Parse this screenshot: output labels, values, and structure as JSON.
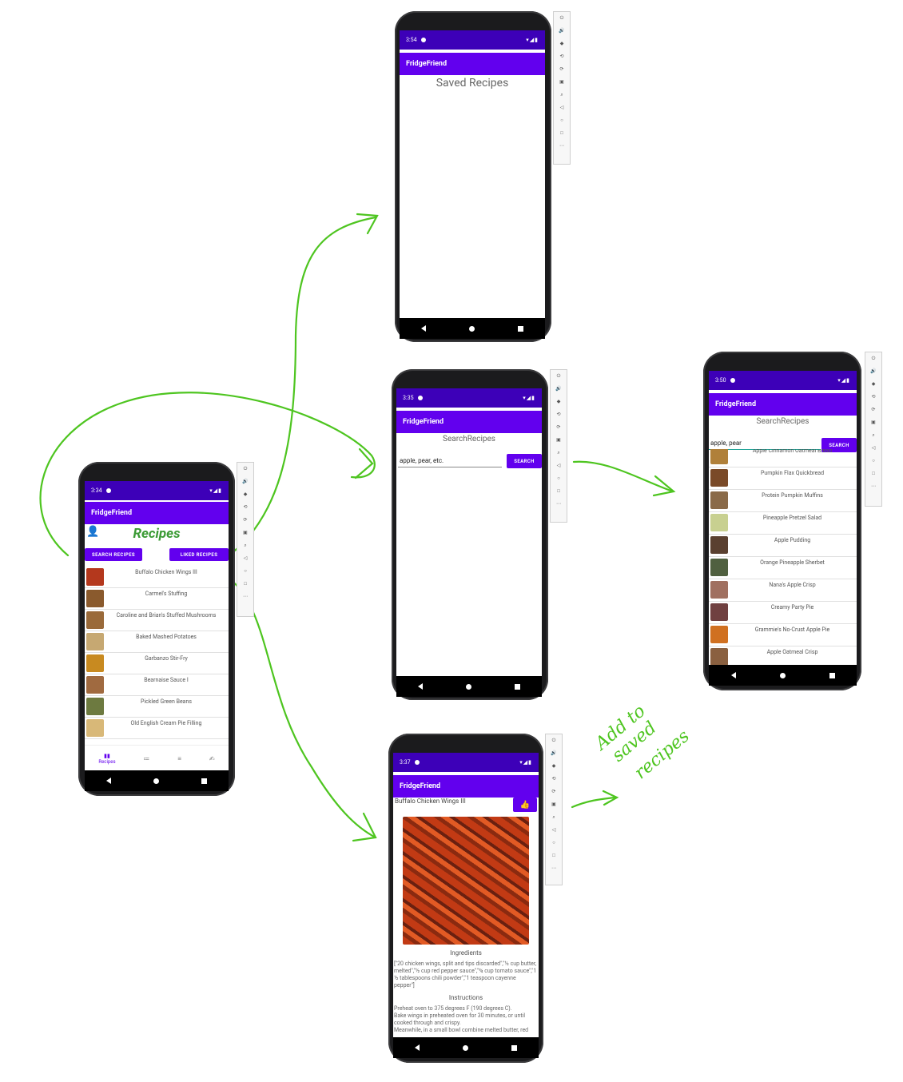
{
  "colors": {
    "accent": "#6200ee",
    "status": "#3d00b8",
    "arrow": "#4ec520",
    "recipes_title": "#3a9a34"
  },
  "screen_main": {
    "time": "3:34",
    "app_title": "FridgeFriend",
    "heading": "Recipes",
    "search_btn": "SEARCH RECIPES",
    "liked_btn": "LIKED RECIPES",
    "recipes": [
      {
        "label": "Buffalo Chicken Wings III",
        "color": "#b4381d"
      },
      {
        "label": "Carmel's Stuffing",
        "color": "#8a5a2d"
      },
      {
        "label": "Caroline and Brian's Stuffed Mushrooms",
        "color": "#9a6a3a"
      },
      {
        "label": "Baked Mashed Potatoes",
        "color": "#c6a872"
      },
      {
        "label": "Garbanzo Stir-Fry",
        "color": "#c88a20"
      },
      {
        "label": "Bearnaise Sauce I",
        "color": "#a06a40"
      },
      {
        "label": "Pickled Green Beans",
        "color": "#6d7a40"
      },
      {
        "label": "Old English Cream Pie Filling",
        "color": "#d8b878"
      }
    ],
    "bottom_nav": {
      "recipes": "Recipes",
      "icon2": "≔",
      "icon3": "≡",
      "icon4": "✍"
    }
  },
  "screen_saved": {
    "time": "3:54",
    "app_title": "FridgeFriend",
    "heading": "Saved Recipes"
  },
  "screen_search": {
    "time": "3:35",
    "app_title": "FridgeFriend",
    "heading": "SearchRecipes",
    "input_value": "apple, pear, etc.",
    "search_btn": "SEARCH"
  },
  "screen_results": {
    "time": "3:50",
    "app_title": "FridgeFriend",
    "heading": "SearchRecipes",
    "input_value": "apple, pear",
    "search_btn": "SEARCH",
    "results": [
      {
        "label": "Apple Cinnamon Oatmeal Bread",
        "color": "#b0803a"
      },
      {
        "label": "Pumpkin Flax Quickbread",
        "color": "#7a4a28"
      },
      {
        "label": "Protein Pumpkin Muffins",
        "color": "#8a6a48"
      },
      {
        "label": "Pineapple Pretzel Salad",
        "color": "#c8d090"
      },
      {
        "label": "Apple Pudding",
        "color": "#5a4030"
      },
      {
        "label": "Orange Pineapple Sherbet",
        "color": "#506040"
      },
      {
        "label": "Nana's Apple Crisp",
        "color": "#a07060"
      },
      {
        "label": "Creamy Party Pie",
        "color": "#704040"
      },
      {
        "label": "Grammie's No-Crust Apple Pie",
        "color": "#d07020"
      },
      {
        "label": "Apple Oatmeal Crisp",
        "color": "#8a6040"
      }
    ]
  },
  "screen_detail": {
    "time": "3:37",
    "app_title": "FridgeFriend",
    "recipe_title": "Buffalo Chicken Wings III",
    "ingredients_heading": "Ingredients",
    "ingredients": "[\"20 chicken wings, split and tips discarded\",\"½ cup butter, melted\",\"½ cup red pepper sauce\",\"¾ cup tomato sauce\",\"1 ½ tablespoons chili powder\",\"1 teaspoon cayenne pepper\"]",
    "instructions_heading": "Instructions",
    "instructions": "Preheat oven to 375 degrees F (190 degrees C).\nBake wings in preheated oven for 30 minutes, or until cooked through and crispy.\nMeanwhile, in a small bowl combine melted butter, red"
  },
  "annotation": {
    "line1": "Add to",
    "line2": "saved",
    "line3": "recipes"
  }
}
